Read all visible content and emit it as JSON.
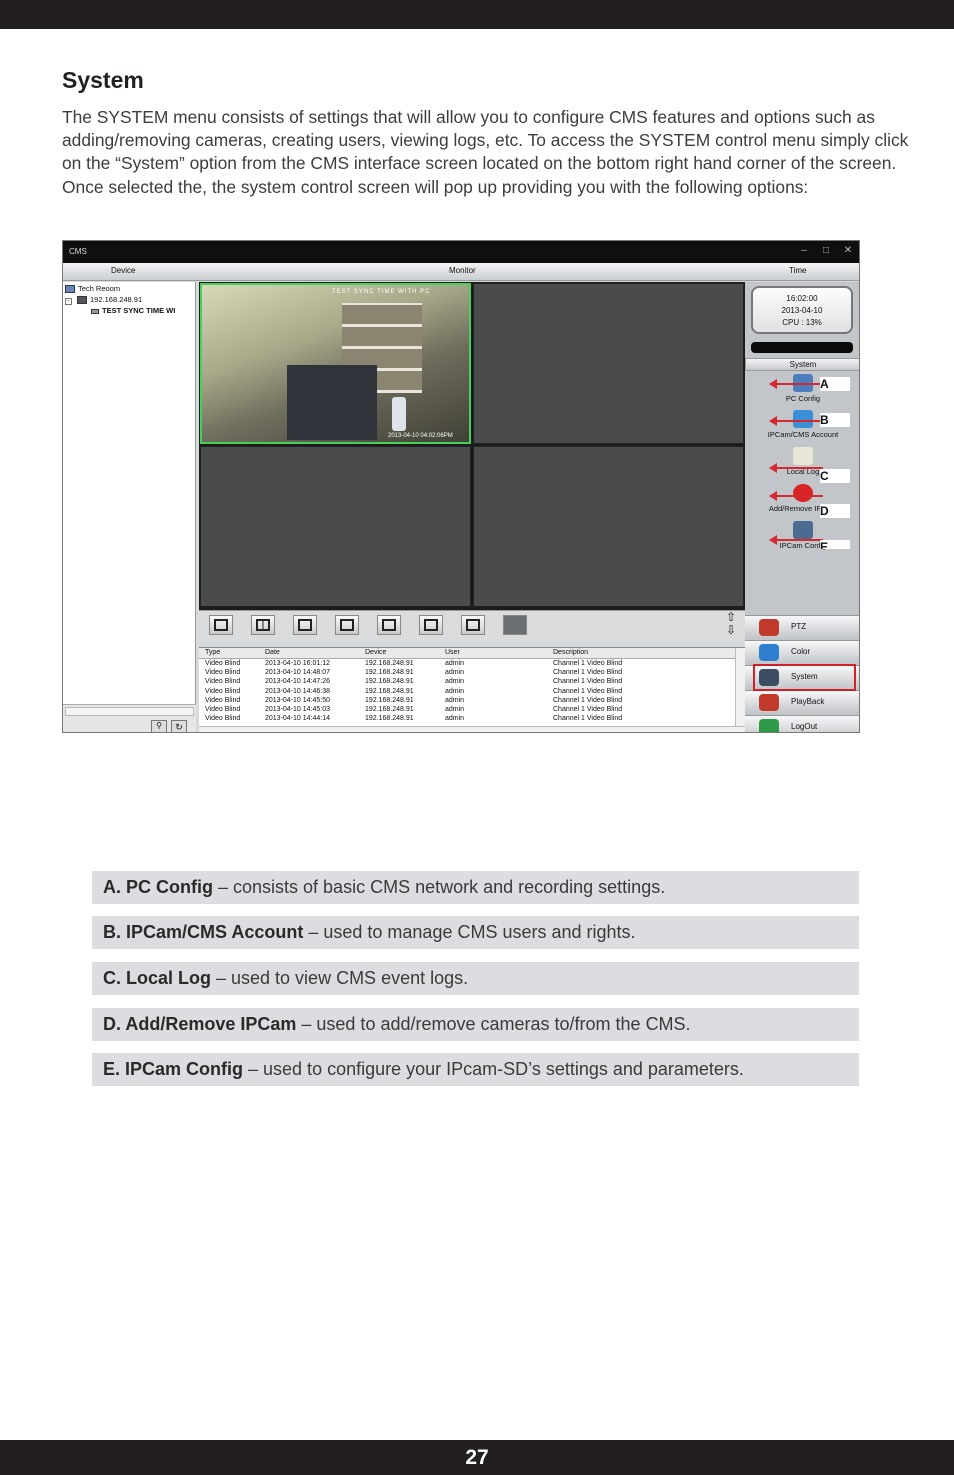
{
  "section_title": "System",
  "intro": "The SYSTEM menu consists of settings that will allow you to configure CMS features and options such as adding/removing cameras, creating users, viewing logs, etc. To access the SYSTEM control menu simply click on the “System” option from the CMS interface screen located on the bottom right hand corner of the screen. Once selected the, the system control screen will pop up providing you with the following options:",
  "cms": {
    "window_title": "CMS",
    "headers": {
      "device": "Device",
      "monitor": "Monitor",
      "time": "Time"
    },
    "tree": {
      "root": "Tech Reoom",
      "ip": "192.168.248.91",
      "camera": "TEST SYNC TIME WI"
    },
    "camera_overlay_top": "TEST SYNC TIME WITH PC",
    "camera_overlay_bottom": "2013-04-10 04:02:06PM",
    "clock": {
      "time": "16:02:00",
      "date": "2013-04-10",
      "cpu": "CPU : 13%"
    },
    "system_header": "System",
    "system_items": [
      {
        "label": "PC Config",
        "icon": "pc-config-icon"
      },
      {
        "label": "IPCam/CMS Account",
        "icon": "users-icon"
      },
      {
        "label": "Local Log",
        "icon": "log-icon"
      },
      {
        "label": "Add/Remove IPCam",
        "icon": "record-icon"
      },
      {
        "label": "IPCam Config",
        "icon": "camera-config-icon"
      }
    ],
    "nav_buttons": [
      {
        "label": "PTZ",
        "icon": "ptz-icon",
        "color": "#c0392b"
      },
      {
        "label": "Color",
        "icon": "color-icon",
        "color": "#2f7fd1"
      },
      {
        "label": "System",
        "icon": "system-icon",
        "color": "#3c4d63"
      },
      {
        "label": "PlayBack",
        "icon": "playback-icon",
        "color": "#c0392b"
      },
      {
        "label": "LogOut",
        "icon": "logout-icon",
        "color": "#2c9a46"
      }
    ],
    "log_columns": [
      "Type",
      "Date",
      "Device",
      "User",
      "Description"
    ],
    "log_rows": [
      [
        "Video Blind",
        "2013-04-10 16:01:12",
        "192.168.248.91",
        "admin",
        "Channel 1 Video Blind"
      ],
      [
        "Video Blind",
        "2013-04-10 14:48:07",
        "192.168.248.91",
        "admin",
        "Channel 1 Video Blind"
      ],
      [
        "Video Blind",
        "2013-04-10 14:47:26",
        "192.168.248.91",
        "admin",
        "Channel 1 Video Blind"
      ],
      [
        "Video Blind",
        "2013-04-10 14:46:38",
        "192.168.248.91",
        "admin",
        "Channel 1 Video Blind"
      ],
      [
        "Video Blind",
        "2013-04-10 14:45:50",
        "192.168.248.91",
        "admin",
        "Channel 1 Video Blind"
      ],
      [
        "Video Blind",
        "2013-04-10 14:45:03",
        "192.168.248.91",
        "admin",
        "Channel 1 Video Blind"
      ],
      [
        "Video Blind",
        "2013-04-10 14:44:14",
        "192.168.248.91",
        "admin",
        "Channel 1 Video Blind"
      ]
    ]
  },
  "annotation_letters": [
    "A",
    "B",
    "C",
    "D",
    "E"
  ],
  "callouts": [
    {
      "term": "A.  PC Config",
      "desc": " – consists of basic CMS network and recording settings."
    },
    {
      "term": "B.  IPCam/CMS Account",
      "desc": " – used to manage CMS users and rights."
    },
    {
      "term": "C.  Local Log",
      "desc": " – used to view CMS event logs."
    },
    {
      "term": "D.  Add/Remove IPCam",
      "desc": " – used to add/remove cameras to/from the CMS."
    },
    {
      "term": "E.  IPCam Config",
      "desc": " – used to configure your IPcam-SD’s settings and parameters."
    }
  ],
  "page_number": "27"
}
